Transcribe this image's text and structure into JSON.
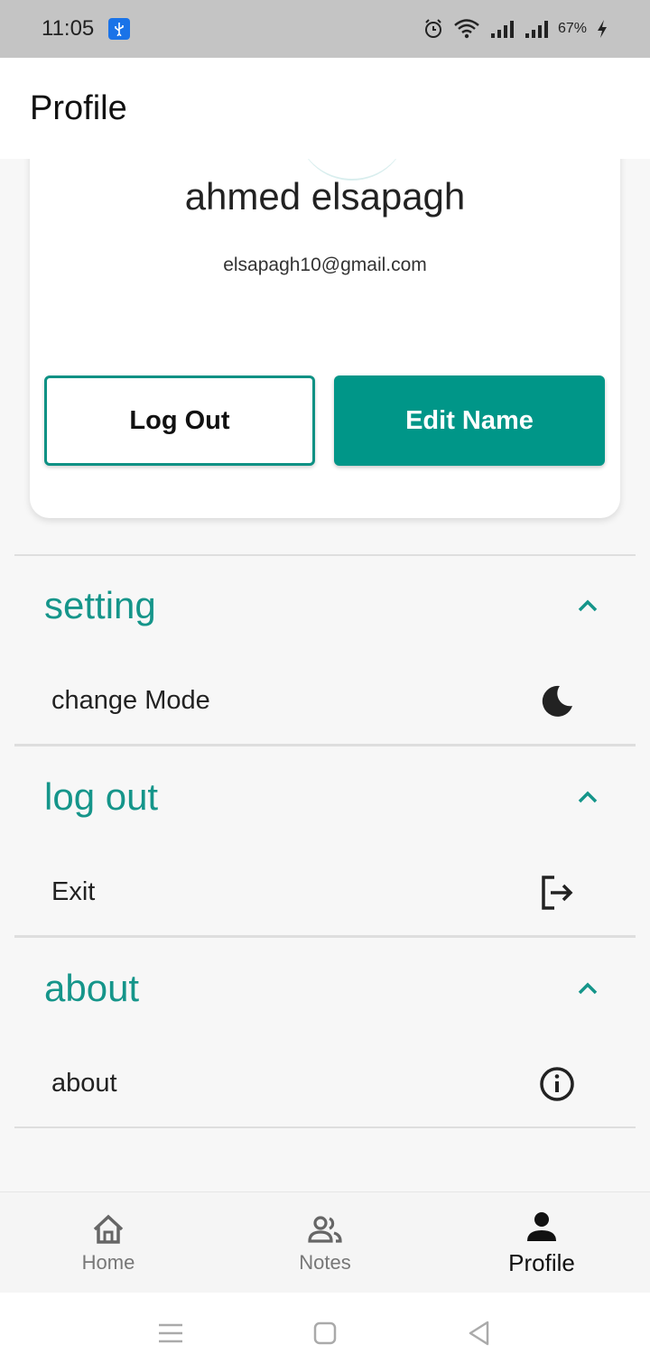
{
  "status_bar": {
    "time": "11:05",
    "battery": "67%",
    "icons": [
      "usb-icon",
      "alarm-icon",
      "wifi-icon",
      "signal-icon",
      "signal-icon",
      "charging-icon"
    ]
  },
  "app_bar": {
    "title": "Profile"
  },
  "profile": {
    "name": "ahmed elsapagh",
    "email": "elsapagh10@gmail.com",
    "logout_button": "Log Out",
    "edit_button": "Edit Name"
  },
  "sections": [
    {
      "title": "setting",
      "item": "change Mode",
      "icon": "moon-icon"
    },
    {
      "title": "log out",
      "item": "Exit",
      "icon": "logout-icon"
    },
    {
      "title": "about",
      "item": "about",
      "icon": "info-icon"
    }
  ],
  "bottom_nav": {
    "items": [
      {
        "label": "Home",
        "icon": "home-icon",
        "active": false
      },
      {
        "label": "Notes",
        "icon": "people-icon",
        "active": false
      },
      {
        "label": "Profile",
        "icon": "person-icon",
        "active": true
      }
    ]
  },
  "colors": {
    "accent": "#009688",
    "section_title": "#15958a",
    "status_bar": "#c4c4c4"
  }
}
